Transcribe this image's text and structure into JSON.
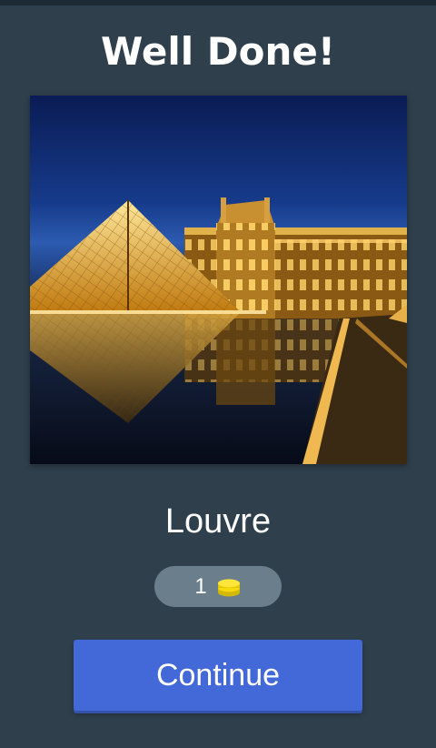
{
  "header": {
    "title": "Well Done!"
  },
  "result": {
    "image_subject": "Louvre pyramid and palace at night",
    "answer": "Louvre",
    "reward": {
      "count": "1",
      "icon": "coin-stack-icon"
    }
  },
  "actions": {
    "continue_label": "Continue"
  },
  "colors": {
    "background": "#2f3f4c",
    "button": "#4369d8",
    "pill": "#6b7e8b",
    "coin": "#f5d90a"
  }
}
